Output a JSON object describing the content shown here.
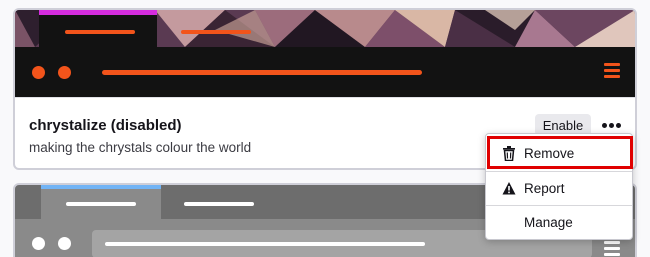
{
  "themes": [
    {
      "name": "chrystalize (disabled)",
      "description": "making the chrystals colour the world",
      "enable_label": "Enable",
      "more_label": "•••",
      "colors": {
        "frame": "#121212",
        "accent_tab": "#d52cde",
        "highlight": "#f2541b"
      }
    },
    {
      "colors": {
        "frame": "#8a8a8a",
        "accent_tab": "#72b4f5",
        "highlight": "#ffffff"
      }
    }
  ],
  "context_menu": {
    "items": [
      {
        "label": "Remove",
        "icon": "trash-icon",
        "highlighted": true
      },
      {
        "label": "Report",
        "icon": "warning-icon"
      },
      {
        "label": "Manage",
        "icon": ""
      }
    ],
    "highlight_color": "#e00000"
  }
}
